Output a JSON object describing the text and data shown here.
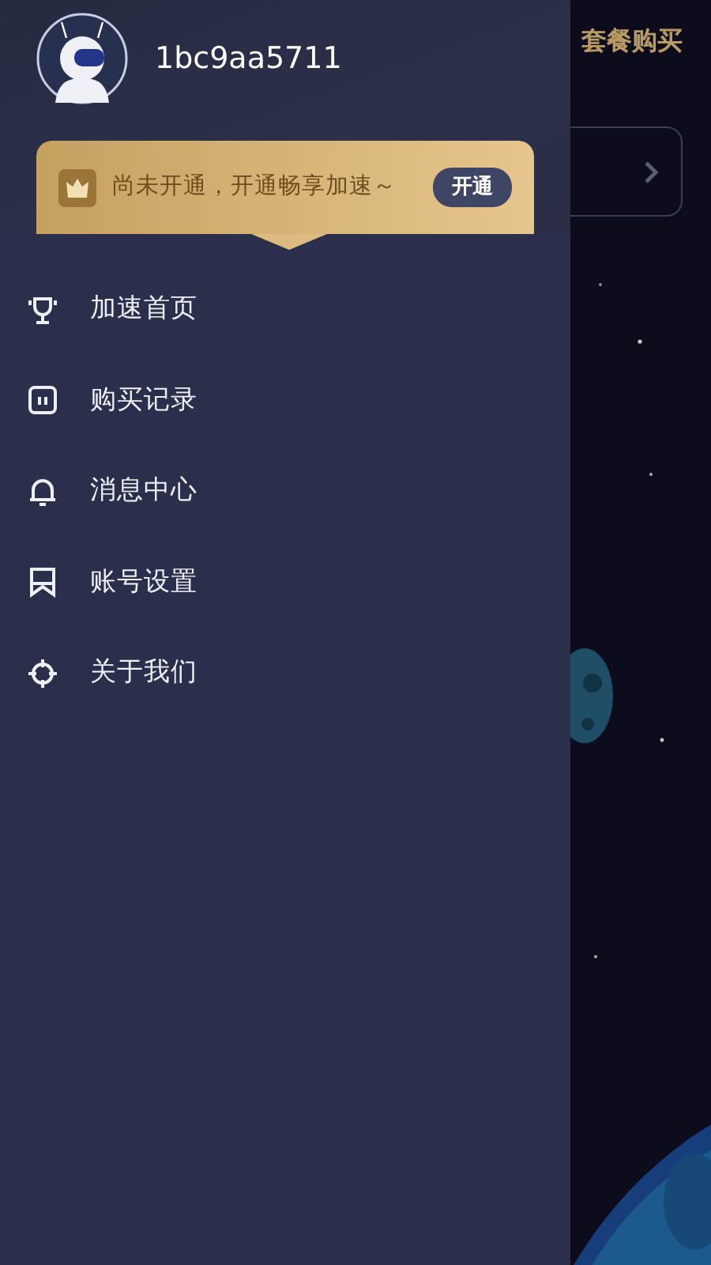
{
  "background": {
    "title": "套餐购买"
  },
  "user": {
    "name": "1bc9aa5711"
  },
  "vip_banner": {
    "text": "尚未开通，开通畅享加速～",
    "button": "开通"
  },
  "menu": [
    {
      "kind": "trophy",
      "label": "加速首页"
    },
    {
      "kind": "receipt",
      "label": "购买记录"
    },
    {
      "kind": "bell",
      "label": "消息中心"
    },
    {
      "kind": "bookmark",
      "label": "账号设置"
    },
    {
      "kind": "target",
      "label": "关于我们"
    }
  ]
}
